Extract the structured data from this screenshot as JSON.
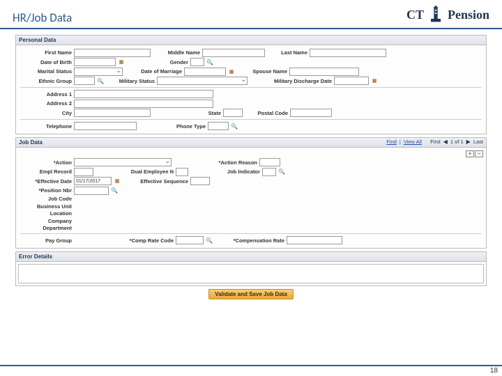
{
  "header": {
    "title": "HR/Job Data",
    "logo_ct": "CT",
    "logo_pension": "Pension"
  },
  "personal": {
    "title": "Personal Data",
    "first_name_lbl": "First Name",
    "middle_name_lbl": "Middle Name",
    "last_name_lbl": "Last Name",
    "dob_lbl": "Date of Birth",
    "gender_lbl": "Gender",
    "marital_lbl": "Marital Status",
    "dom_lbl": "Date of Marriage",
    "spouse_lbl": "Spouse Name",
    "ethnic_lbl": "Ethnic Group",
    "milstat_lbl": "Military Status",
    "mildis_lbl": "Military Discharge Date",
    "addr1_lbl": "Address 1",
    "addr2_lbl": "Address 2",
    "city_lbl": "City",
    "state_lbl": "State",
    "postal_lbl": "Postal Code",
    "tel_lbl": "Telephone",
    "ptype_lbl": "Phone Type"
  },
  "job": {
    "title": "Job Data",
    "nav_find": "Find",
    "nav_viewall": "View All",
    "nav_first": "First",
    "nav_count": "1 of 1",
    "nav_last": "Last",
    "action_lbl": "*Action",
    "reason_lbl": "*Action Reason",
    "empl_lbl": "Empl Record",
    "dual_lbl": "Dual Employee N",
    "jobind_lbl": "Job Indicator",
    "effdate_lbl": "*Effective Date",
    "effdate_val": "01/17/2017",
    "effseq_lbl": "Effective Sequence",
    "posnbr_lbl": "*Position Nbr",
    "jobcode_lbl": "Job Code",
    "bu_lbl": "Business Unit",
    "loc_lbl": "Location",
    "company_lbl": "Company",
    "dept_lbl": "Department",
    "paygrp_lbl": "Pay Group",
    "comprate_lbl": "*Comp Rate Code",
    "comp_lbl": "*Compensation Rate",
    "plus": "+",
    "minus": "−"
  },
  "errors": {
    "title": "Error Details"
  },
  "button": {
    "label": "Validate and Save Job Data"
  },
  "slide_number": "18"
}
